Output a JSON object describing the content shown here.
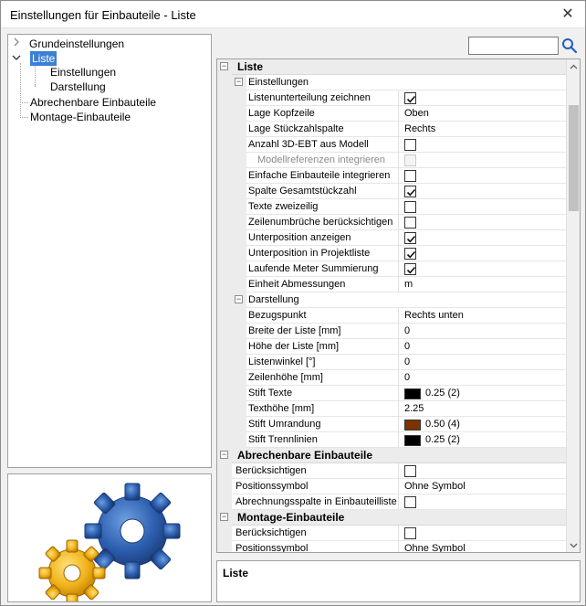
{
  "window": {
    "title": "Einstellungen für Einbauteile - Liste",
    "close_glyph": "✕"
  },
  "tree": {
    "items": [
      {
        "label": "Grundeinstellungen",
        "expander": "collapsed"
      },
      {
        "label": "Liste",
        "expander": "expanded",
        "selected": true
      },
      {
        "label": "Einstellungen"
      },
      {
        "label": "Darstellung"
      },
      {
        "label": "Abrechenbare Einbauteile"
      },
      {
        "label": "Montage-Einbauteile"
      }
    ]
  },
  "search": {
    "value": "",
    "placeholder": ""
  },
  "colors": {
    "selection": "#3c7fd5",
    "stift_texte": "#000000",
    "stift_umrandung": "#7b3300",
    "stift_trennlinien": "#000000"
  },
  "grid": {
    "rows": [
      {
        "kind": "cat",
        "name": "Liste"
      },
      {
        "kind": "subcat",
        "name": "Einstellungen"
      },
      {
        "kind": "prop",
        "name": "Listenunterteilung zeichnen",
        "type": "check",
        "checked": true
      },
      {
        "kind": "prop",
        "name": "Lage Kopfzeile",
        "type": "text",
        "value": "Oben"
      },
      {
        "kind": "prop",
        "name": "Lage Stückzahlspalte",
        "type": "text",
        "value": "Rechts"
      },
      {
        "kind": "prop",
        "name": "Anzahl 3D-EBT aus Modell",
        "type": "check",
        "checked": false
      },
      {
        "kind": "prop",
        "name": "Modellreferenzen integrieren",
        "type": "check",
        "checked": false,
        "disabled": true,
        "indent": true
      },
      {
        "kind": "prop",
        "name": "Einfache Einbauteile integrieren",
        "type": "check",
        "checked": false
      },
      {
        "kind": "prop",
        "name": "Spalte Gesamtstückzahl",
        "type": "check",
        "checked": true
      },
      {
        "kind": "prop",
        "name": "Texte zweizeilig",
        "type": "check",
        "checked": false
      },
      {
        "kind": "prop",
        "name": "Zeilenumbrüche berücksichtigen",
        "type": "check",
        "checked": false
      },
      {
        "kind": "prop",
        "name": "Unterposition anzeigen",
        "type": "check",
        "checked": true
      },
      {
        "kind": "prop",
        "name": "Unterposition in Projektliste",
        "type": "check",
        "checked": true
      },
      {
        "kind": "prop",
        "name": "Laufende Meter Summierung",
        "type": "check",
        "checked": true
      },
      {
        "kind": "prop",
        "name": "Einheit Abmessungen",
        "type": "text",
        "value": "m"
      },
      {
        "kind": "subcat",
        "name": "Darstellung"
      },
      {
        "kind": "prop",
        "name": "Bezugspunkt",
        "type": "text",
        "value": "Rechts unten"
      },
      {
        "kind": "prop",
        "name": "Breite der Liste [mm]",
        "type": "text",
        "value": "0"
      },
      {
        "kind": "prop",
        "name": "Höhe der Liste [mm]",
        "type": "text",
        "value": "0"
      },
      {
        "kind": "prop",
        "name": "Listenwinkel [°]",
        "type": "text",
        "value": "0"
      },
      {
        "kind": "prop",
        "name": "Zeilenhöhe [mm]",
        "type": "text",
        "value": "0"
      },
      {
        "kind": "prop",
        "name": "Stift Texte",
        "type": "color",
        "color": "#000000",
        "value": "0.25 (2)"
      },
      {
        "kind": "prop",
        "name": "Texthöhe [mm]",
        "type": "text",
        "value": "2.25"
      },
      {
        "kind": "prop",
        "name": "Stift Umrandung",
        "type": "color",
        "color": "#7b3300",
        "value": "0.50 (4)"
      },
      {
        "kind": "prop",
        "name": "Stift Trennlinien",
        "type": "color",
        "color": "#000000",
        "value": "0.25 (2)"
      },
      {
        "kind": "cat",
        "name": "Abrechenbare Einbauteile"
      },
      {
        "kind": "prop1",
        "name": "Berücksichtigen",
        "type": "check",
        "checked": false
      },
      {
        "kind": "prop1",
        "name": "Positionssymbol",
        "type": "text",
        "value": "Ohne Symbol"
      },
      {
        "kind": "prop1",
        "name": "Abrechnungsspalte in Einbauteilliste",
        "type": "check",
        "checked": false
      },
      {
        "kind": "cat",
        "name": "Montage-Einbauteile"
      },
      {
        "kind": "prop1",
        "name": "Berücksichtigen",
        "type": "check",
        "checked": false
      },
      {
        "kind": "prop1",
        "name": "Positionssymbol",
        "type": "text",
        "value": "Ohne Symbol"
      }
    ]
  },
  "description": {
    "title": "Liste"
  }
}
